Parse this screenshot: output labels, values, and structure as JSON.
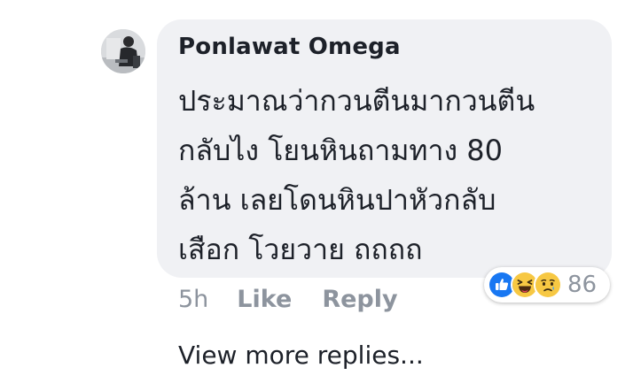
{
  "comment": {
    "author": "Ponlawat Omega",
    "text_lines": [
      "ประมาณว่ากวนตีนมากวนตีน",
      "กลับไง โยนหินถามทาง 80",
      "ล้าน เลยโดนหินปาหัวกลับ",
      "เสือก โวยวาย ถถถถ"
    ],
    "time": "5h",
    "like_label": "Like",
    "reply_label": "Reply",
    "reactions": {
      "types": [
        "like-icon",
        "laugh-icon",
        "sad-icon"
      ],
      "count": "86"
    }
  },
  "view_more_replies": "View more replies...",
  "colors": {
    "bubble": "#f0f1f4",
    "text": "#1d2129",
    "meta": "#8d949e",
    "like_blue": "#1877f2",
    "emoji_yellow": "#f7c843"
  }
}
